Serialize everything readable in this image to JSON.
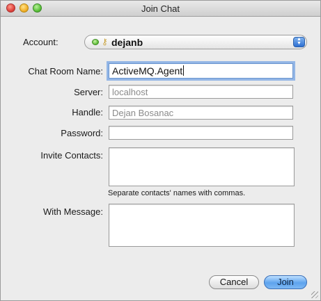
{
  "window": {
    "title": "Join Chat"
  },
  "account": {
    "label": "Account:",
    "value": "dejanb"
  },
  "chat_room": {
    "label": "Chat Room Name:",
    "value": "ActiveMQ.Agent"
  },
  "server": {
    "label": "Server:",
    "placeholder": "localhost"
  },
  "handle": {
    "label": "Handle:",
    "placeholder": "Dejan Bosanac"
  },
  "password": {
    "label": "Password:",
    "value": ""
  },
  "invite": {
    "label": "Invite Contacts:",
    "hint": "Separate contacts' names with commas."
  },
  "message": {
    "label": "With Message:"
  },
  "buttons": {
    "cancel": "Cancel",
    "join": "Join"
  }
}
